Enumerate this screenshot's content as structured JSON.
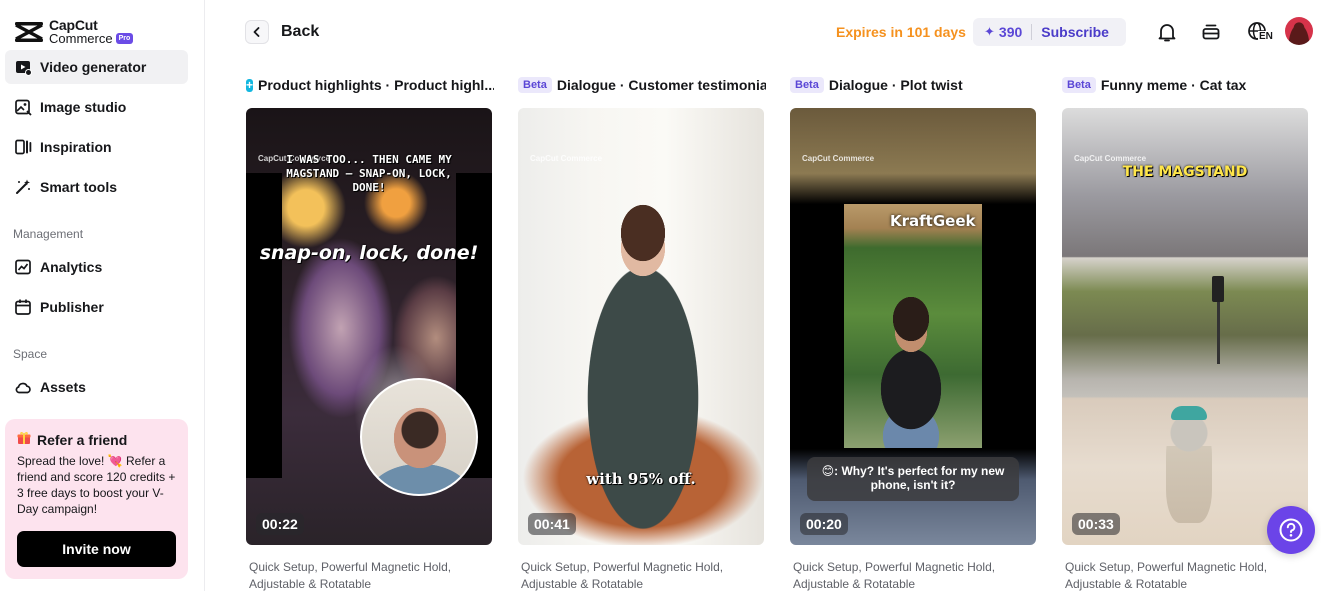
{
  "brand": {
    "name": "CapCut",
    "sub": "Commerce",
    "badge": "Pro"
  },
  "sidebar": {
    "items": [
      {
        "label": "Video generator",
        "icon": "video-add-icon",
        "active": true
      },
      {
        "label": "Image studio",
        "icon": "image-edit-icon"
      },
      {
        "label": "Inspiration",
        "icon": "inspiration-icon"
      },
      {
        "label": "Smart tools",
        "icon": "magic-wand-icon"
      }
    ],
    "management_label": "Management",
    "management": [
      {
        "label": "Analytics",
        "icon": "chart-icon"
      },
      {
        "label": "Publisher",
        "icon": "calendar-icon"
      }
    ],
    "space_label": "Space",
    "space": [
      {
        "label": "Assets",
        "icon": "cloud-icon"
      }
    ],
    "refer": {
      "title": "Refer a friend",
      "text": "Spread the love! 💘 Refer a friend and score 120 credits + 3 free days to boost your V-Day campaign!",
      "button": "Invite now"
    }
  },
  "topbar": {
    "back_label": "Back",
    "expires": "Expires in 101 days",
    "credits": "390",
    "subscribe": "Subscribe",
    "lang": "EN"
  },
  "cards": [
    {
      "badge": "",
      "title": "Product highlights · Product highl...",
      "duration": "00:22",
      "caption_top": "I WAS TOO... THEN CAME MY MAGSTAND – SNAP-ON, LOCK, DONE!",
      "caption_mid": "snap-on, lock, done!",
      "desc": "Quick Setup, Powerful Magnetic Hold, Adjustable & Rotatable"
    },
    {
      "badge": "Beta",
      "title": "Dialogue · Customer testimonial",
      "duration": "00:41",
      "caption_bottom": "with 95% off.",
      "desc": "Quick Setup, Powerful Magnetic Hold, Adjustable & Rotatable"
    },
    {
      "badge": "Beta",
      "title": "Dialogue · Plot twist",
      "duration": "00:20",
      "overlay_title": "KraftGeek",
      "bubble": "😊: Why? It's perfect for my new phone, isn't it?",
      "desc": "Quick Setup, Powerful Magnetic Hold, Adjustable & Rotatable"
    },
    {
      "badge": "Beta",
      "title": "Funny meme · Cat tax",
      "duration": "00:33",
      "caption_top": "THE MAGSTAND",
      "desc": "Quick Setup, Powerful Magnetic Hold, Adjustable & Rotatable"
    }
  ],
  "watermark": "CapCut Commerce",
  "colors": {
    "accent": "#5b47d6",
    "expires": "#f5911e",
    "refer_bg": "#fde3ee",
    "help": "#6b44e8"
  }
}
